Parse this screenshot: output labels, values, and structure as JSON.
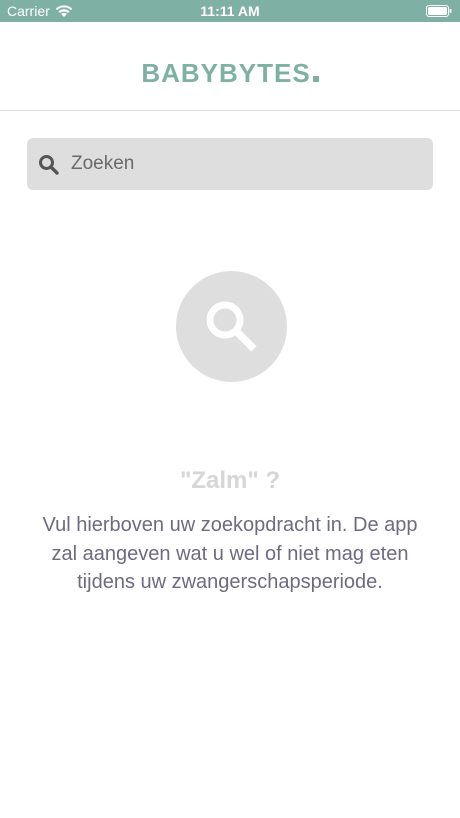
{
  "status_bar": {
    "carrier": "Carrier",
    "time": "11:11 AM",
    "wifi_icon": "wifi-icon",
    "battery_icon": "battery-icon",
    "background_color": "#7fb0a4"
  },
  "header": {
    "logo_text": "BABYBYTES",
    "accent_color": "#7fb0a4"
  },
  "search": {
    "placeholder": "Zoeken",
    "value": "",
    "icon": "search-icon"
  },
  "empty_state": {
    "icon": "magnifier-icon",
    "title": "\"Zalm\" ?",
    "message": "Vul hierboven uw zoekopdracht in. De app zal aangeven wat u wel of niet mag eten tijdens uw zwangerschapsperiode."
  }
}
